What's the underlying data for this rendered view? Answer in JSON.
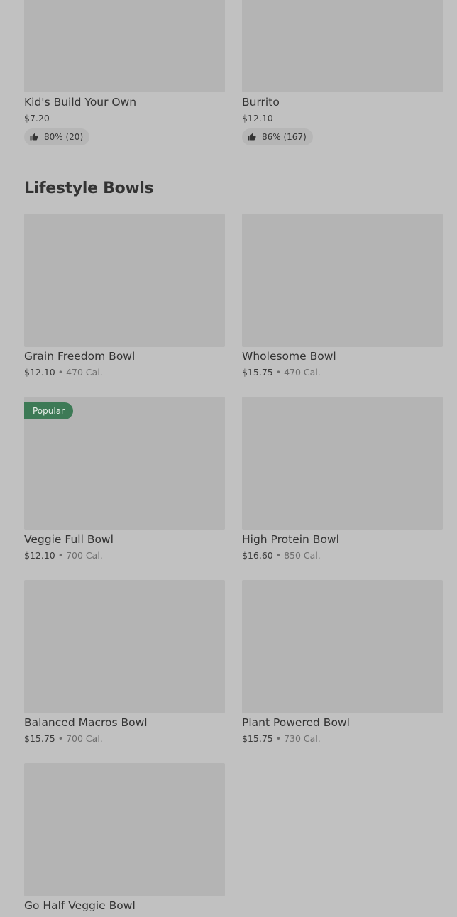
{
  "top_items": [
    {
      "name": "Kid's Build Your Own",
      "price": "$7.20",
      "rating": "80% (20)"
    },
    {
      "name": "Burrito",
      "price": "$12.10",
      "rating": "86% (167)"
    }
  ],
  "section": {
    "title": "Lifestyle Bowls"
  },
  "bowls": [
    {
      "name": "Grain Freedom Bowl",
      "price": "$12.10",
      "calories": "470 Cal."
    },
    {
      "name": "Wholesome Bowl",
      "price": "$15.75",
      "calories": "470 Cal."
    },
    {
      "name": "Veggie Full Bowl",
      "price": "$12.10",
      "calories": "700 Cal.",
      "badge": "Popular"
    },
    {
      "name": "High Protein Bowl",
      "price": "$16.60",
      "calories": "850 Cal."
    },
    {
      "name": "Balanced Macros Bowl",
      "price": "$15.75",
      "calories": "700 Cal."
    },
    {
      "name": "Plant Powered Bowl",
      "price": "$15.75",
      "calories": "730 Cal."
    },
    {
      "name": "Go Half Veggie Bowl"
    }
  ],
  "separator": "•",
  "icons": {
    "rating": "thumbs-up-icon"
  },
  "colors": {
    "background": "#c1c1c1",
    "image_placeholder": "#b4b4b4",
    "badge": "#3d7a56"
  }
}
